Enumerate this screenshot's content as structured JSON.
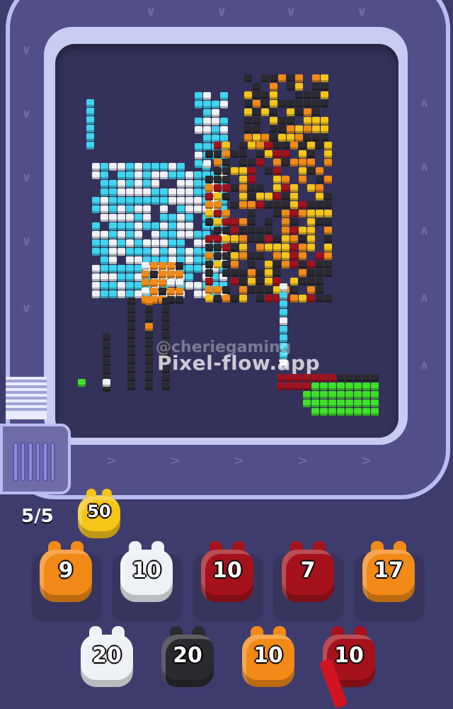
{
  "watermark": {
    "handle": "@cheriegaming",
    "site": "Pixel-flow.app"
  },
  "counter": {
    "text": "5/5"
  },
  "colors": {
    "cyan": "#3fd4f0",
    "white": "#eef2f6",
    "black": "#2a2a30",
    "orange": "#f28a17",
    "yellow": "#f5c518",
    "red": "#a5121c",
    "green": "#3ee02a",
    "belt": "#524f88",
    "board": "#34325a"
  },
  "queue_pig": {
    "value": "50",
    "color": "yellow"
  },
  "rows": [
    [
      {
        "value": "9",
        "color": "orange"
      },
      {
        "value": "10",
        "color": "white"
      },
      {
        "value": "10",
        "color": "red"
      },
      {
        "value": "7",
        "color": "red"
      },
      {
        "value": "17",
        "color": "orange"
      }
    ],
    [
      {
        "value": "20",
        "color": "white"
      },
      {
        "value": "20",
        "color": "black"
      },
      {
        "value": "10",
        "color": "orange"
      },
      {
        "value": "10",
        "color": "red"
      }
    ]
  ]
}
